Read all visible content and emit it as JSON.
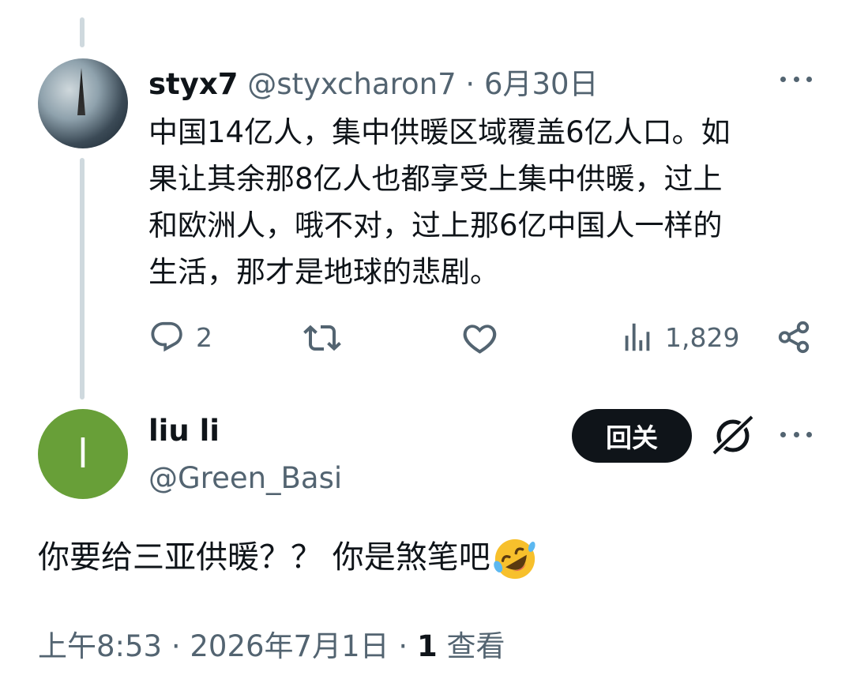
{
  "parent_tweet": {
    "display_name": "styx7",
    "handle": "@styxcharon7",
    "separator": " · ",
    "date": "6月30日",
    "text_lines": [
      "中国14亿人，集中供暖区域覆盖6亿人口。如",
      "果让其余那8亿人也都享受上集中供暖，过上",
      "和欧洲人，哦不对，过上那6亿中国人一样的",
      "生活，那才是地球的悲剧。"
    ],
    "replies": "2",
    "views": "1,829"
  },
  "reply_tweet": {
    "display_name": "liu li",
    "avatar_letter": "l",
    "avatar_color": "#689f38",
    "handle": "@Green_Basi",
    "follow_back_label": "回关",
    "text": "你要给三亚供暖？？ 你是煞笔吧",
    "emoji": "rolling-on-floor-laughing",
    "time": "上午8:53",
    "separator": " · ",
    "date": "2026年7月1日",
    "view_count": "1",
    "view_label": "查看"
  },
  "colors": {
    "text": "#0f1419",
    "muted": "#536471",
    "thread_line": "#cfd9de",
    "button_bg": "#0f1419"
  }
}
